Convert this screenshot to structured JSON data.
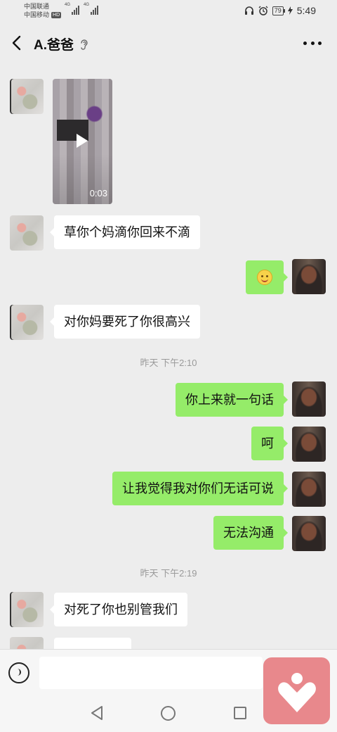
{
  "status_bar": {
    "carrier1": "中国联通",
    "carrier2": "中国移动",
    "hd_badge": "HD",
    "network1": "4G",
    "network2": "4G",
    "battery": "79",
    "time": "5:49"
  },
  "header": {
    "title": "A.爸爸"
  },
  "messages": [
    {
      "side": "left",
      "type": "video",
      "duration": "0:03"
    },
    {
      "side": "left",
      "type": "text",
      "text": "草你个妈滴你回来不滴"
    },
    {
      "side": "right",
      "type": "emoji",
      "emoji": "smile"
    },
    {
      "side": "left",
      "type": "text",
      "text": "对你妈要死了你很高兴"
    },
    {
      "type": "time",
      "text": "昨天 下午2:10"
    },
    {
      "side": "right",
      "type": "text",
      "text": "你上来就一句话"
    },
    {
      "side": "right",
      "type": "text",
      "text": "呵"
    },
    {
      "side": "right",
      "type": "text",
      "text": "让我觉得我对你们无话可说"
    },
    {
      "side": "right",
      "type": "text",
      "text": "无法沟通"
    },
    {
      "type": "time",
      "text": "昨天 下午2:19"
    },
    {
      "side": "left",
      "type": "text",
      "text": "对死了你也别管我们"
    },
    {
      "side": "left",
      "type": "text",
      "text": ""
    }
  ],
  "input": {
    "value": "",
    "placeholder": ""
  },
  "colors": {
    "background": "#ededed",
    "my_bubble": "#95ec69",
    "their_bubble": "#ffffff",
    "sticker_button": "#e8888c"
  },
  "icons": [
    "back-arrow-icon",
    "ear-icon",
    "more-icon",
    "play-icon",
    "voice-icon",
    "heart-icon",
    "nav-back-icon",
    "nav-home-icon",
    "nav-recent-icon"
  ]
}
